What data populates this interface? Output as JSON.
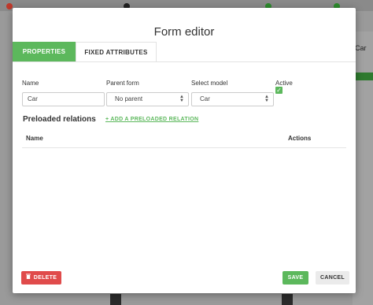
{
  "modal": {
    "title": "Form editor",
    "tabs": [
      {
        "label": "PROPERTIES",
        "active": true
      },
      {
        "label": "FIXED ATTRIBUTES",
        "active": false
      }
    ],
    "fields": {
      "name": {
        "label": "Name",
        "value": "Car"
      },
      "parent_form": {
        "label": "Parent form",
        "value": "No parent"
      },
      "select_model": {
        "label": "Select model",
        "value": "Car"
      },
      "active": {
        "label": "Active",
        "checked": true
      }
    },
    "preloaded": {
      "title": "Preloaded relations",
      "add_link": "+ ADD A PRELOADED RELATION",
      "columns": [
        "Name",
        "Actions"
      ],
      "rows": []
    },
    "footer": {
      "delete_label": "DELETE",
      "save_label": "SAVE",
      "cancel_label": "CANCEL"
    }
  },
  "colors": {
    "accent": "#5cb85c",
    "danger": "#e04b4b",
    "overlay": "#9a9a9a"
  }
}
